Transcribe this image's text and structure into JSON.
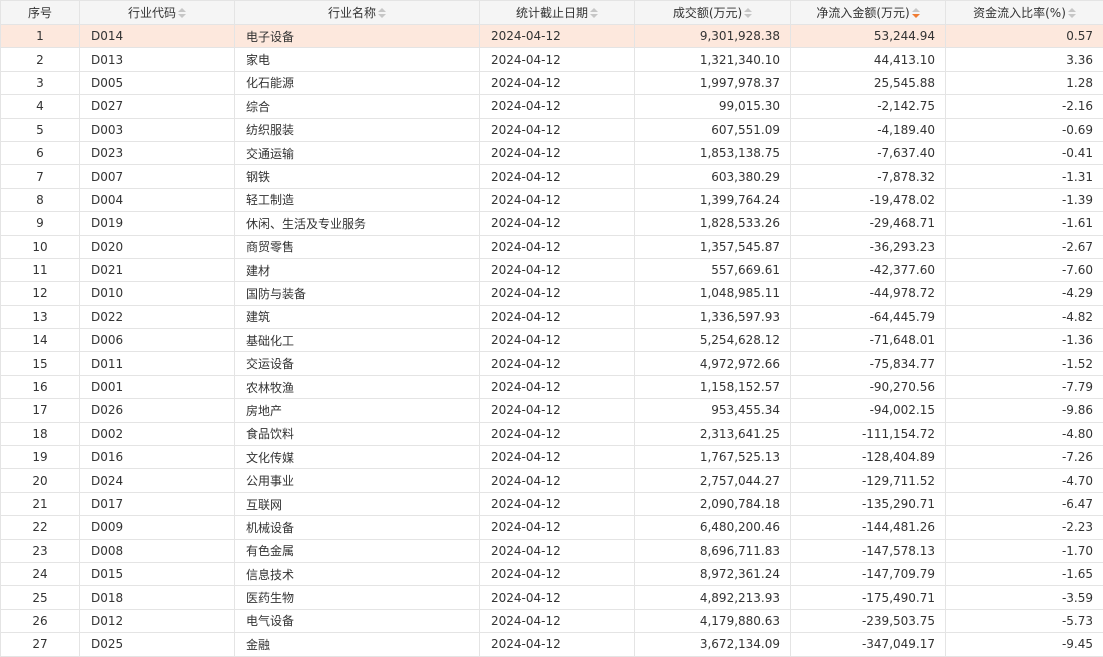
{
  "table": {
    "columns": [
      {
        "label": "序号",
        "sortable": false
      },
      {
        "label": "行业代码",
        "sortable": true
      },
      {
        "label": "行业名称",
        "sortable": true
      },
      {
        "label": "统计截止日期",
        "sortable": true
      },
      {
        "label": "成交额(万元)",
        "sortable": true
      },
      {
        "label": "净流入金额(万元)",
        "sortable": true,
        "active_sort": "desc"
      },
      {
        "label": "资金流入比率(%)",
        "sortable": true
      }
    ],
    "highlight_row": 0,
    "colors": {
      "highlight": "#fde8dd",
      "header_bg": "#f5f5f5",
      "sort_active": "#f07c33",
      "border": "#e4e4e4"
    },
    "rows": [
      [
        "1",
        "D014",
        "电子设备",
        "2024-04-12",
        "9,301,928.38",
        "53,244.94",
        "0.57"
      ],
      [
        "2",
        "D013",
        "家电",
        "2024-04-12",
        "1,321,340.10",
        "44,413.10",
        "3.36"
      ],
      [
        "3",
        "D005",
        "化石能源",
        "2024-04-12",
        "1,997,978.37",
        "25,545.88",
        "1.28"
      ],
      [
        "4",
        "D027",
        "综合",
        "2024-04-12",
        "99,015.30",
        "-2,142.75",
        "-2.16"
      ],
      [
        "5",
        "D003",
        "纺织服装",
        "2024-04-12",
        "607,551.09",
        "-4,189.40",
        "-0.69"
      ],
      [
        "6",
        "D023",
        "交通运输",
        "2024-04-12",
        "1,853,138.75",
        "-7,637.40",
        "-0.41"
      ],
      [
        "7",
        "D007",
        "钢铁",
        "2024-04-12",
        "603,380.29",
        "-7,878.32",
        "-1.31"
      ],
      [
        "8",
        "D004",
        "轻工制造",
        "2024-04-12",
        "1,399,764.24",
        "-19,478.02",
        "-1.39"
      ],
      [
        "9",
        "D019",
        "休闲、生活及专业服务",
        "2024-04-12",
        "1,828,533.26",
        "-29,468.71",
        "-1.61"
      ],
      [
        "10",
        "D020",
        "商贸零售",
        "2024-04-12",
        "1,357,545.87",
        "-36,293.23",
        "-2.67"
      ],
      [
        "11",
        "D021",
        "建材",
        "2024-04-12",
        "557,669.61",
        "-42,377.60",
        "-7.60"
      ],
      [
        "12",
        "D010",
        "国防与装备",
        "2024-04-12",
        "1,048,985.11",
        "-44,978.72",
        "-4.29"
      ],
      [
        "13",
        "D022",
        "建筑",
        "2024-04-12",
        "1,336,597.93",
        "-64,445.79",
        "-4.82"
      ],
      [
        "14",
        "D006",
        "基础化工",
        "2024-04-12",
        "5,254,628.12",
        "-71,648.01",
        "-1.36"
      ],
      [
        "15",
        "D011",
        "交运设备",
        "2024-04-12",
        "4,972,972.66",
        "-75,834.77",
        "-1.52"
      ],
      [
        "16",
        "D001",
        "农林牧渔",
        "2024-04-12",
        "1,158,152.57",
        "-90,270.56",
        "-7.79"
      ],
      [
        "17",
        "D026",
        "房地产",
        "2024-04-12",
        "953,455.34",
        "-94,002.15",
        "-9.86"
      ],
      [
        "18",
        "D002",
        "食品饮料",
        "2024-04-12",
        "2,313,641.25",
        "-111,154.72",
        "-4.80"
      ],
      [
        "19",
        "D016",
        "文化传媒",
        "2024-04-12",
        "1,767,525.13",
        "-128,404.89",
        "-7.26"
      ],
      [
        "20",
        "D024",
        "公用事业",
        "2024-04-12",
        "2,757,044.27",
        "-129,711.52",
        "-4.70"
      ],
      [
        "21",
        "D017",
        "互联网",
        "2024-04-12",
        "2,090,784.18",
        "-135,290.71",
        "-6.47"
      ],
      [
        "22",
        "D009",
        "机械设备",
        "2024-04-12",
        "6,480,200.46",
        "-144,481.26",
        "-2.23"
      ],
      [
        "23",
        "D008",
        "有色金属",
        "2024-04-12",
        "8,696,711.83",
        "-147,578.13",
        "-1.70"
      ],
      [
        "24",
        "D015",
        "信息技术",
        "2024-04-12",
        "8,972,361.24",
        "-147,709.79",
        "-1.65"
      ],
      [
        "25",
        "D018",
        "医药生物",
        "2024-04-12",
        "4,892,213.93",
        "-175,490.71",
        "-3.59"
      ],
      [
        "26",
        "D012",
        "电气设备",
        "2024-04-12",
        "4,179,880.63",
        "-239,503.75",
        "-5.73"
      ],
      [
        "27",
        "D025",
        "金融",
        "2024-04-12",
        "3,672,134.09",
        "-347,049.17",
        "-9.45"
      ]
    ]
  }
}
